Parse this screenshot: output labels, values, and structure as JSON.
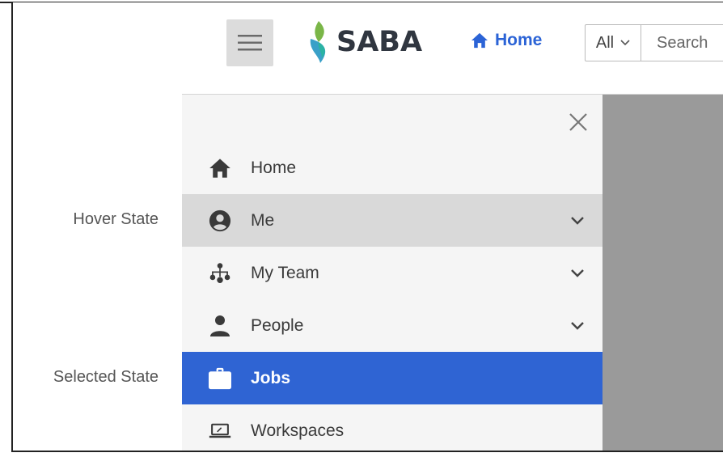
{
  "header": {
    "logo_text": "SABA",
    "home_label": "Home",
    "search_scope": "All",
    "search_placeholder": "Search"
  },
  "annotations": {
    "hover_label": "Hover State",
    "selected_label": "Selected State"
  },
  "menu": {
    "items": [
      {
        "label": "Home",
        "icon": "home-icon",
        "has_chevron": false,
        "state": "normal"
      },
      {
        "label": "Me",
        "icon": "account-circle-icon",
        "has_chevron": true,
        "state": "hover"
      },
      {
        "label": "My Team",
        "icon": "org-chart-icon",
        "has_chevron": true,
        "state": "normal"
      },
      {
        "label": "People",
        "icon": "person-icon",
        "has_chevron": true,
        "state": "normal"
      },
      {
        "label": "Jobs",
        "icon": "briefcase-icon",
        "has_chevron": false,
        "state": "selected"
      },
      {
        "label": "Workspaces",
        "icon": "laptop-icon",
        "has_chevron": false,
        "state": "normal"
      }
    ]
  },
  "colors": {
    "accent": "#2f64d3",
    "hover_bg": "#d9d9d9",
    "overlay": "#9a9a9a",
    "menu_bg": "#f5f5f5"
  }
}
